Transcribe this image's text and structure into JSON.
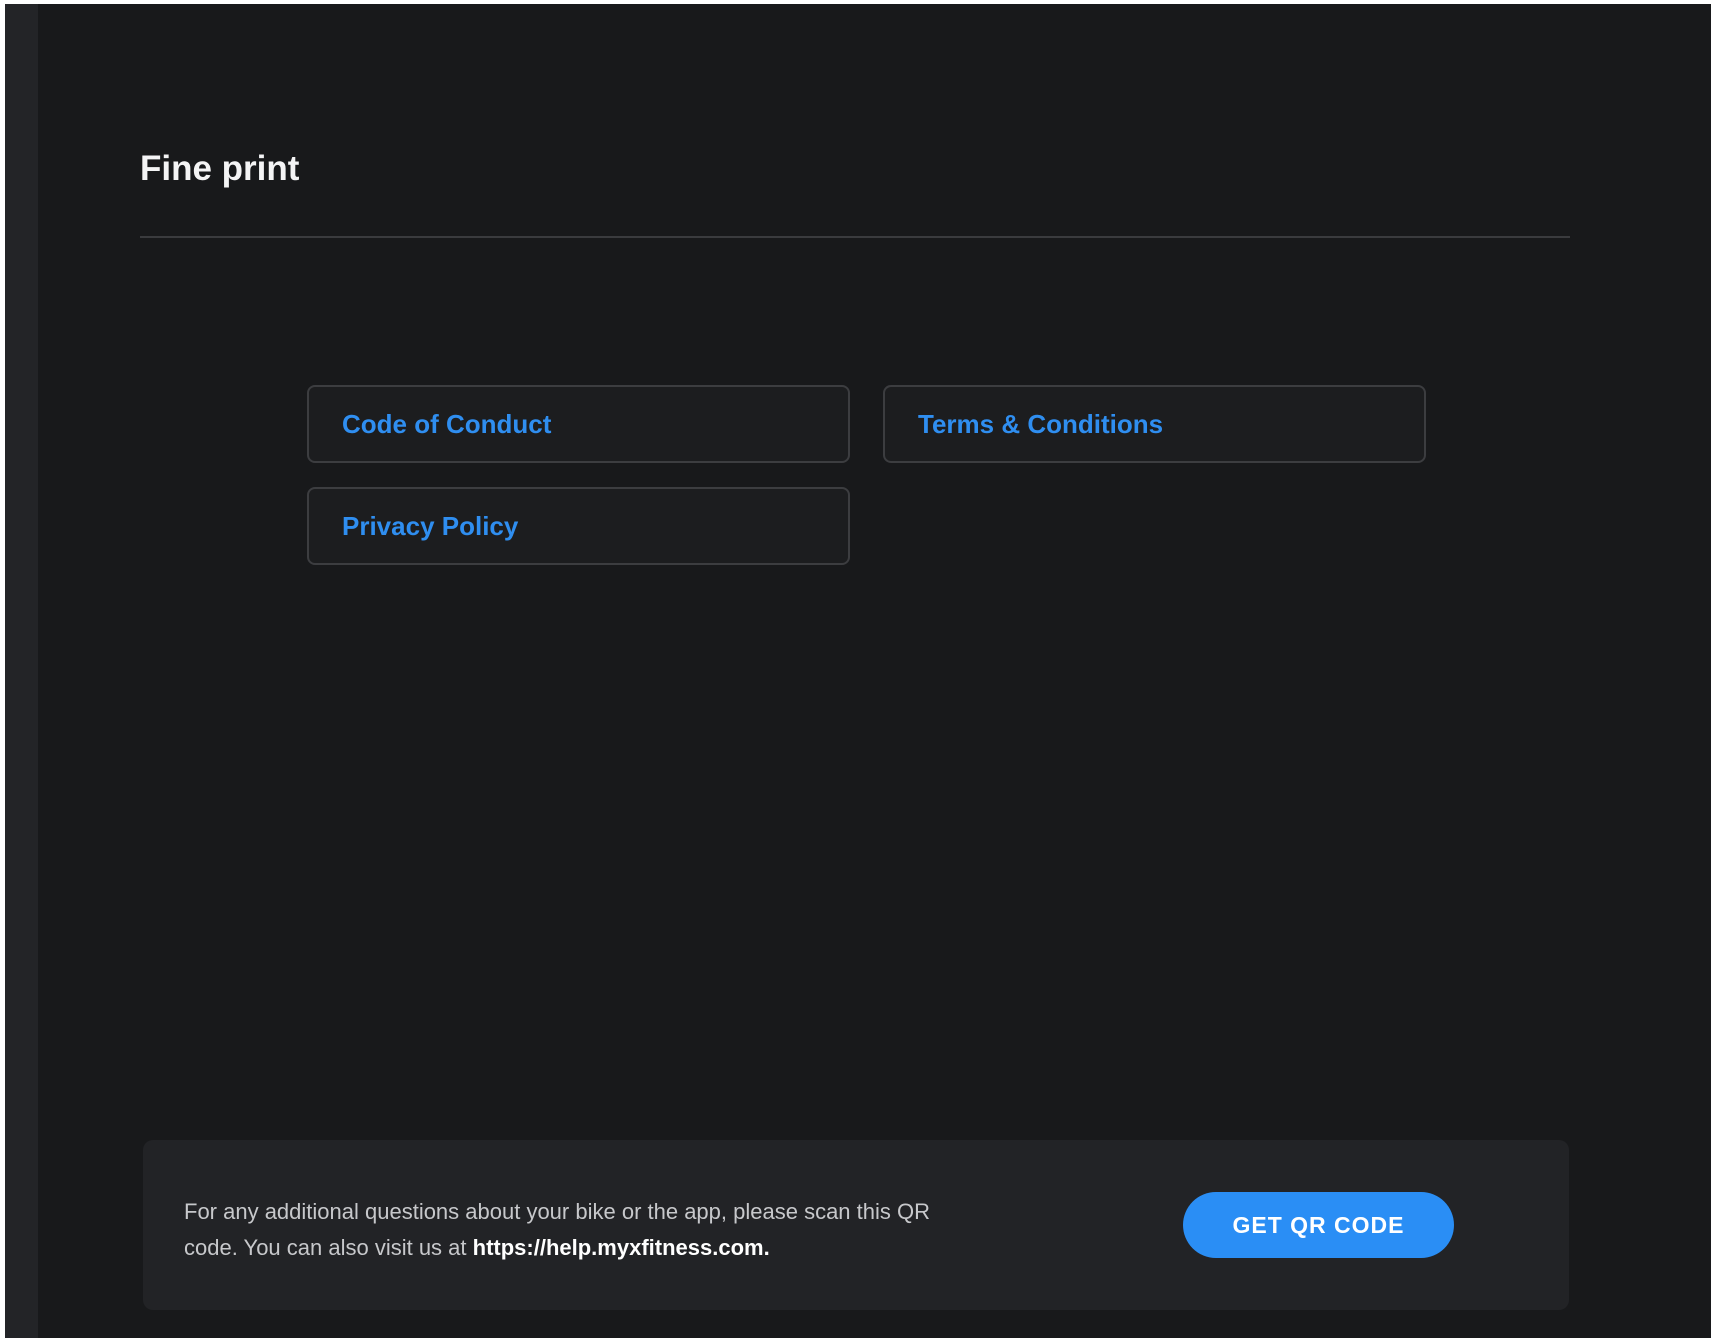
{
  "page": {
    "title": "Fine print"
  },
  "links": [
    {
      "label": "Code of Conduct"
    },
    {
      "label": "Terms & Conditions"
    },
    {
      "label": "Privacy Policy"
    }
  ],
  "help": {
    "text_prefix": "For any additional questions about your bike or the app, please scan this QR code. You can also visit us at ",
    "url": "https://help.myxfitness.com.",
    "button_label": "GET QR CODE"
  },
  "colors": {
    "background": "#18191b",
    "link": "#2f8ef0",
    "button": "#2a8ef5",
    "panel": "#222326"
  }
}
